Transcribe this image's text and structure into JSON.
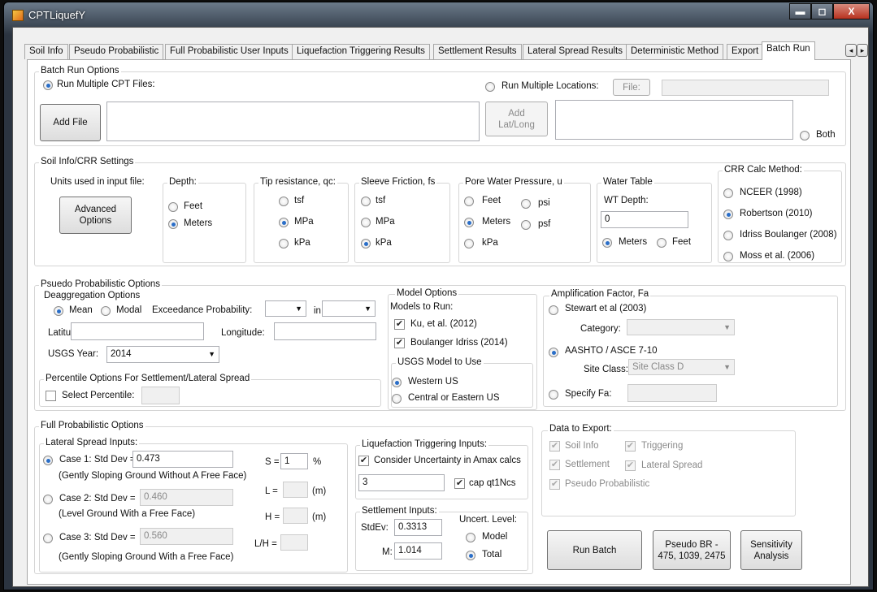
{
  "window": {
    "title": "CPTLiquefY",
    "min": "▬",
    "max": "◻",
    "close": "X"
  },
  "tabs": [
    "Soil Info",
    "Pseudo Probabilistic",
    "Full Probabilistic User Inputs",
    "Liquefaction Triggering Results",
    "Settlement Results",
    "Lateral Spread Results",
    "Deterministic Method",
    "Export",
    "Batch Run"
  ],
  "tab_scroll": {
    "left": "◂",
    "right": "▸"
  },
  "batch": {
    "group": "Batch Run Options",
    "run_multiple_cpt": "Run Multiple CPT Files:",
    "run_multiple_locations": "Run Multiple Locations:",
    "file_btn": "File:",
    "add_file": "Add File",
    "add_latlong_1": "Add",
    "add_latlong_2": "Lat/Long",
    "both": "Both"
  },
  "soil": {
    "group": "Soil Info/CRR Settings",
    "units_label": "Units used in input file:",
    "advanced_1": "Advanced",
    "advanced_2": "Options",
    "depth": {
      "label": "Depth:",
      "feet": "Feet",
      "meters": "Meters"
    },
    "tip": {
      "label": "Tip resistance, qc:",
      "tsf": "tsf",
      "mpa": "MPa",
      "kpa": "kPa"
    },
    "sleeve": {
      "label": "Sleeve Friction, fs",
      "tsf": "tsf",
      "mpa": "MPa",
      "kpa": "kPa"
    },
    "pore": {
      "label": "Pore Water Pressure, u",
      "feet": "Feet",
      "psi": "psi",
      "meters": "Meters",
      "psf": "psf",
      "kpa": "kPa"
    },
    "wt": {
      "label": "Water Table",
      "depth_label": "WT Depth:",
      "depth_value": "0",
      "meters": "Meters",
      "feet": "Feet"
    },
    "crr": {
      "label": "CRR Calc Method:",
      "nceer": "NCEER (1998)",
      "robertson": "Robertson (2010)",
      "idriss": "Idriss Boulanger (2008)",
      "moss": "Moss et al. (2006)"
    }
  },
  "pseudo": {
    "group": "Psuedo Probabilistic Options",
    "deagg": "Deaggregation Options",
    "mean": "Mean",
    "modal": "Modal",
    "exceed": "Exceedance Probability:",
    "in": "in",
    "latitude": "Latitude:",
    "longitude": "Longitude:",
    "usgs_year_label": "USGS Year:",
    "usgs_year": "2014",
    "percentile_group": "Percentile Options For Settlement/Lateral Spread",
    "select_percentile": "Select Percentile:",
    "model_group": "Model Options",
    "models_to_run": "Models to Run:",
    "ku": "Ku, et al. (2012)",
    "boulanger": "Boulanger Idriss (2014)",
    "usgs_model_group": "USGS Model to Use",
    "western": "Western US",
    "central": "Central or Eastern US",
    "amp_group": "Amplification Factor, Fa",
    "stewart": "Stewart et al (2003)",
    "category": "Category:",
    "aashto": "AASHTO / ASCE 7-10",
    "site_class_label": "Site Class:",
    "site_class": "Site Class D",
    "specify_fa": "Specify Fa:"
  },
  "full": {
    "group": "Full Probabilistic Options",
    "lateral_group": "Lateral Spread Inputs:",
    "case1": "Case 1: Std Dev =",
    "case1_val": "0.473",
    "case1_desc": "(Gently Sloping Ground Without A Free Face)",
    "case2": "Case 2: Std Dev =",
    "case2_val": "0.460",
    "case2_desc": "(Level Ground With a Free Face)",
    "case3": "Case 3: Std Dev =",
    "case3_val": "0.560",
    "case3_desc": "(Gently Sloping Ground With a Free Face)",
    "s_label": "S =",
    "s_val": "1",
    "s_unit": "%",
    "l_label": "L =",
    "l_unit": "(m)",
    "h_label": "H =",
    "h_unit": "(m)",
    "lh_label": "L/H =",
    "trig_group": "Liquefaction Triggering Inputs:",
    "consider": "Consider Uncertainty in Amax calcs",
    "trig_val": "3",
    "cap": "cap qt1Ncs",
    "settle_group": "Settlement Inputs:",
    "stdev_label": "StdEv:",
    "stdev_val": "0.3313",
    "m_label": "M:",
    "m_val": "1.014",
    "uncert": "Uncert. Level:",
    "model": "Model",
    "total": "Total"
  },
  "export": {
    "group": "Data to Export:",
    "soil_info": "Soil Info",
    "triggering": "Triggering",
    "settlement": "Settlement",
    "lateral": "Lateral Spread",
    "pseudo": "Pseudo Probabilistic"
  },
  "actions": {
    "run_batch": "Run Batch",
    "pseudo_br_1": "Pseudo BR -",
    "pseudo_br_2": "475, 1039, 2475",
    "sens_1": "Sensitivity",
    "sens_2": "Analysis"
  },
  "check": "✔"
}
